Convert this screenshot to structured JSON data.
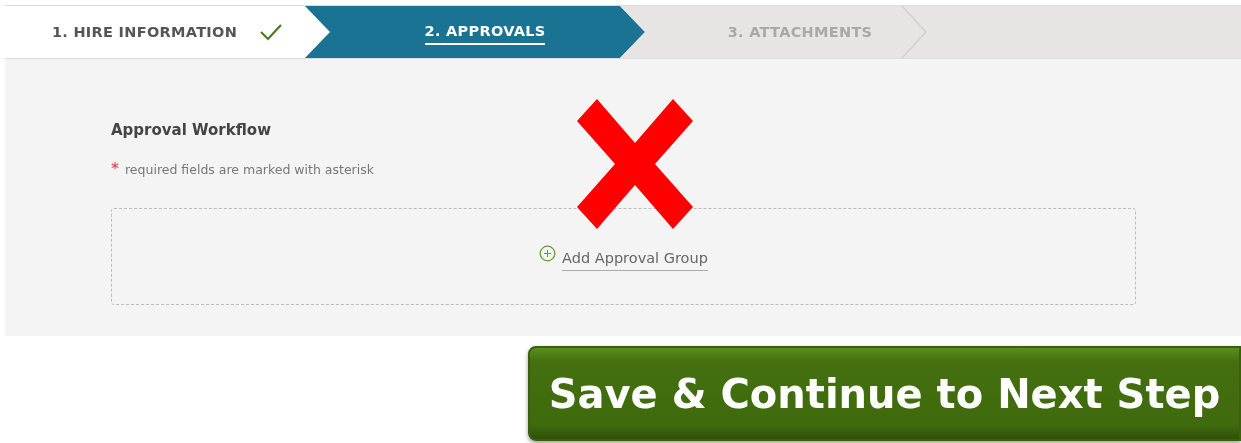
{
  "steps": [
    {
      "label": "1. HIRE INFORMATION",
      "completed": true,
      "selected": false
    },
    {
      "label": "2. APPROVALS",
      "completed": false,
      "selected": true
    },
    {
      "label": "3. ATTACHMENTS",
      "completed": false,
      "selected": false
    }
  ],
  "section": {
    "title": "Approval Workflow",
    "required_mark": "*",
    "required_note": "required fields are marked with asterisk",
    "add_link": "Add Approval Group"
  },
  "annotation": {
    "kind": "cross"
  },
  "primary_button": "Save & Continue to Next Step"
}
